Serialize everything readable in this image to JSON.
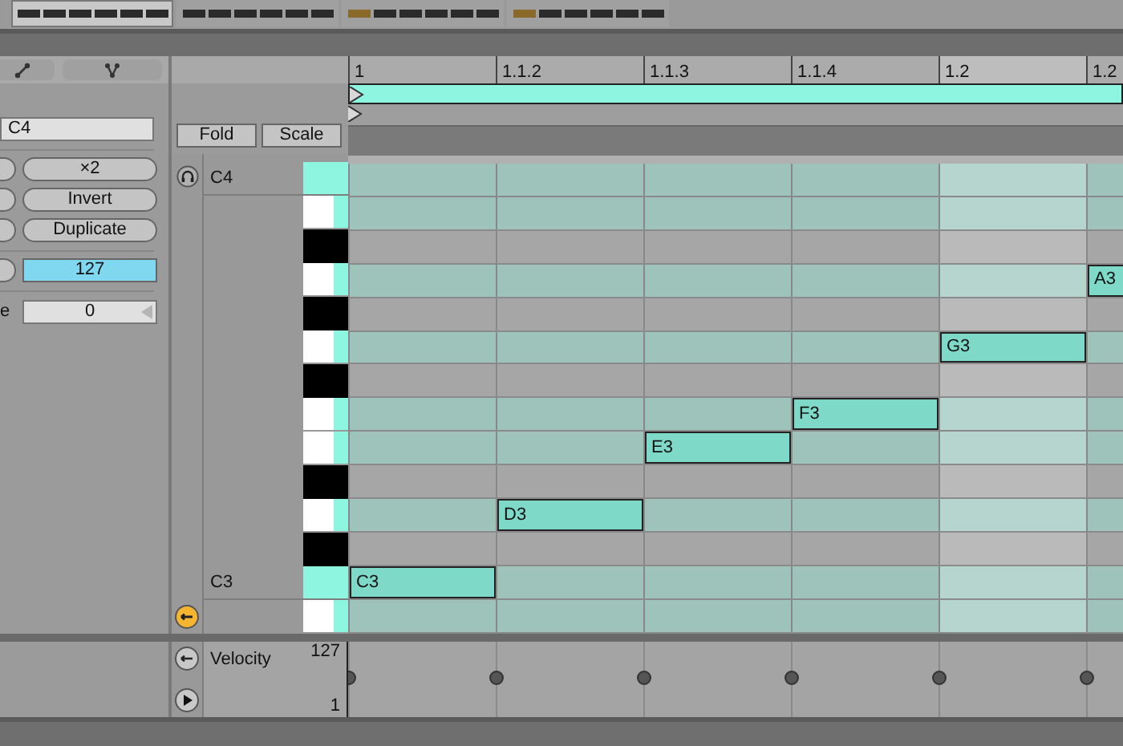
{
  "clip_slots": [
    {
      "selected": true,
      "first_step_lit": false
    },
    {
      "selected": false,
      "first_step_lit": false
    },
    {
      "selected": false,
      "first_step_lit": true
    },
    {
      "selected": false,
      "first_step_lit": true
    }
  ],
  "left_panel": {
    "note_field": "C4",
    "buttons": [
      "×2",
      "Invert",
      "Duplicate"
    ],
    "velocity_field": "127",
    "cut_label": "e",
    "value_field": "0"
  },
  "fold_button": "Fold",
  "scale_button": "Scale",
  "ruler": [
    {
      "label": "1",
      "shaded": false
    },
    {
      "label": "1.1.2",
      "shaded": false
    },
    {
      "label": "1.1.3",
      "shaded": false
    },
    {
      "label": "1.1.4",
      "shaded": false
    },
    {
      "label": "1.2",
      "shaded": true
    },
    {
      "label": "1.2",
      "shaded": false
    }
  ],
  "rows": [
    {
      "kind": "root",
      "in_scale": true,
      "label": "C4",
      "cells": [
        {
          "kind": "empty"
        },
        {
          "kind": "empty"
        },
        {
          "kind": "empty"
        },
        {
          "kind": "empty"
        },
        {
          "kind": "empty"
        },
        {
          "kind": "empty"
        }
      ]
    },
    {
      "kind": "white",
      "in_scale": true,
      "cells": [
        {
          "kind": "empty"
        },
        {
          "kind": "empty"
        },
        {
          "kind": "empty"
        },
        {
          "kind": "empty"
        },
        {
          "kind": "empty"
        },
        {
          "kind": "empty"
        }
      ]
    },
    {
      "kind": "black",
      "in_scale": false,
      "cells": [
        {
          "kind": "empty"
        },
        {
          "kind": "empty"
        },
        {
          "kind": "empty"
        },
        {
          "kind": "empty"
        },
        {
          "kind": "empty"
        },
        {
          "kind": "empty"
        }
      ]
    },
    {
      "kind": "white",
      "in_scale": true,
      "cells": [
        {
          "kind": "empty"
        },
        {
          "kind": "empty"
        },
        {
          "kind": "empty"
        },
        {
          "kind": "empty"
        },
        {
          "kind": "empty"
        },
        {
          "kind": "note",
          "label": "A3"
        }
      ]
    },
    {
      "kind": "black",
      "in_scale": false,
      "cells": [
        {
          "kind": "empty"
        },
        {
          "kind": "empty"
        },
        {
          "kind": "empty"
        },
        {
          "kind": "empty"
        },
        {
          "kind": "empty"
        },
        {
          "kind": "empty"
        }
      ]
    },
    {
      "kind": "white",
      "in_scale": true,
      "cells": [
        {
          "kind": "empty"
        },
        {
          "kind": "empty"
        },
        {
          "kind": "empty"
        },
        {
          "kind": "empty"
        },
        {
          "kind": "note",
          "label": "G3"
        },
        {
          "kind": "empty"
        }
      ]
    },
    {
      "kind": "black",
      "in_scale": false,
      "cells": [
        {
          "kind": "empty"
        },
        {
          "kind": "empty"
        },
        {
          "kind": "empty"
        },
        {
          "kind": "empty"
        },
        {
          "kind": "empty"
        },
        {
          "kind": "empty"
        }
      ]
    },
    {
      "kind": "white",
      "in_scale": true,
      "cells": [
        {
          "kind": "empty"
        },
        {
          "kind": "empty"
        },
        {
          "kind": "empty"
        },
        {
          "kind": "note",
          "label": "F3"
        },
        {
          "kind": "empty"
        },
        {
          "kind": "empty"
        }
      ]
    },
    {
      "kind": "white",
      "in_scale": true,
      "cells": [
        {
          "kind": "empty"
        },
        {
          "kind": "empty"
        },
        {
          "kind": "note",
          "label": "E3"
        },
        {
          "kind": "empty"
        },
        {
          "kind": "empty"
        },
        {
          "kind": "empty"
        }
      ]
    },
    {
      "kind": "black",
      "in_scale": false,
      "cells": [
        {
          "kind": "empty"
        },
        {
          "kind": "empty"
        },
        {
          "kind": "empty"
        },
        {
          "kind": "empty"
        },
        {
          "kind": "empty"
        },
        {
          "kind": "empty"
        }
      ]
    },
    {
      "kind": "white",
      "in_scale": true,
      "cells": [
        {
          "kind": "empty"
        },
        {
          "kind": "note",
          "label": "D3"
        },
        {
          "kind": "empty"
        },
        {
          "kind": "empty"
        },
        {
          "kind": "empty"
        },
        {
          "kind": "empty"
        }
      ]
    },
    {
      "kind": "black",
      "in_scale": false,
      "cells": [
        {
          "kind": "empty"
        },
        {
          "kind": "empty"
        },
        {
          "kind": "empty"
        },
        {
          "kind": "empty"
        },
        {
          "kind": "empty"
        },
        {
          "kind": "empty"
        }
      ]
    },
    {
      "kind": "root",
      "in_scale": true,
      "label": "C3",
      "cells": [
        {
          "kind": "note",
          "label": "C3"
        },
        {
          "kind": "empty"
        },
        {
          "kind": "empty"
        },
        {
          "kind": "empty"
        },
        {
          "kind": "empty"
        },
        {
          "kind": "empty"
        }
      ]
    },
    {
      "kind": "white",
      "in_scale": true,
      "cells": [
        {
          "kind": "empty"
        },
        {
          "kind": "empty"
        },
        {
          "kind": "empty"
        },
        {
          "kind": "empty"
        },
        {
          "kind": "empty"
        },
        {
          "kind": "empty"
        }
      ]
    }
  ],
  "velocity": {
    "label": "Velocity",
    "max": "127",
    "min": "1"
  }
}
